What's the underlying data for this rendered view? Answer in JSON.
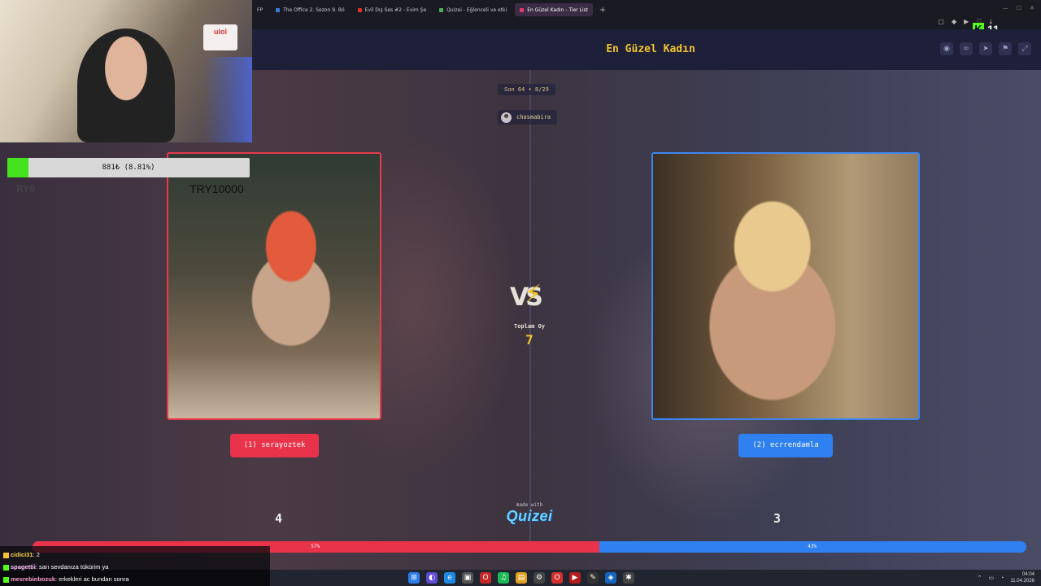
{
  "browser": {
    "tabs": [
      {
        "label": "FP",
        "active": false
      },
      {
        "label": "The Office 2. Sezon 9. Bö",
        "active": false
      },
      {
        "label": "Evil Dış Ses #2 - Evim Şe",
        "active": false
      },
      {
        "label": "Quizei - Eğlenceli ve etki",
        "active": false
      },
      {
        "label": "En Güzel Kadın - Tier List",
        "active": true
      }
    ],
    "kick_count": "11"
  },
  "page": {
    "title": "En Güzel Kadın"
  },
  "quiz": {
    "round": "Son 64 • 8/29",
    "creator": "chasmabira",
    "total_label": "Toplam Oy",
    "total_votes": "7",
    "left": {
      "button": "(1) serayoztek",
      "votes": "4",
      "percent_label": "57%",
      "share": 0.57
    },
    "right": {
      "button": "(2) ecrrendamla",
      "votes": "3",
      "percent_label": "43%",
      "share": 0.43
    },
    "made_with": "made with",
    "brand": "Quizei"
  },
  "overlay": {
    "donate": "881₺ (8.81%)",
    "donate_share": 0.0881,
    "try_text": "TRY10000",
    "ry_text": "RY0",
    "sign_text": "ulol"
  },
  "chat": [
    {
      "user": "cidici31",
      "message": ": 2"
    },
    {
      "user": "spagettii",
      "message": ": sarı sevdanıza tükürim ya"
    },
    {
      "user": "mesrebinbozuk",
      "message": ": erkekleri ac bundan sonra"
    }
  ],
  "clock": {
    "time": "04:04",
    "date": "11.04.2026"
  },
  "colors": {
    "left_accent": "#e8334a",
    "right_accent": "#2f80f0",
    "title": "#f2c230"
  }
}
